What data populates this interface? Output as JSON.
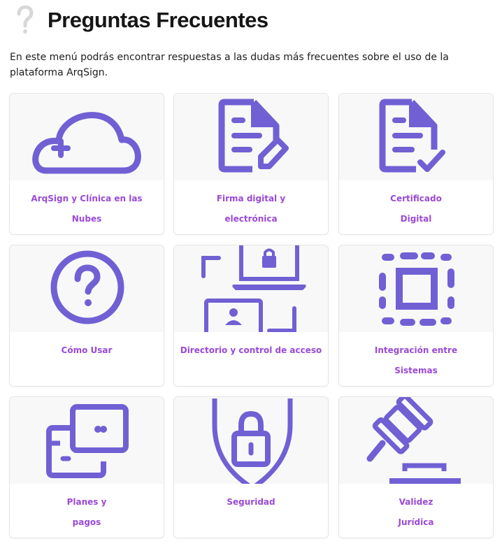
{
  "header": {
    "title": "Preguntas Frecuentes",
    "icon": "question-mark-icon"
  },
  "intro": "En este menú podrás encontrar respuestas a las dudas más frecuentes sobre el uso de la plataforma ArqSign.",
  "colors": {
    "accent": "#7060d4",
    "label": "#9a4ad6",
    "card_top": "#f8f8f8"
  },
  "cards": [
    {
      "icon": "cloud-plus-icon",
      "lines": [
        "ArqSign y Clínica en las Nubes"
      ]
    },
    {
      "icon": "document-edit-icon",
      "lines": [
        "Firma digital y",
        "electrónica"
      ]
    },
    {
      "icon": "document-check-icon",
      "lines": [
        "Certificado",
        "Digital"
      ]
    },
    {
      "icon": "question-circle-icon",
      "lines": [
        "Cómo Usar"
      ]
    },
    {
      "icon": "access-directory-icon",
      "lines": [
        "Directorio y control de acceso"
      ]
    },
    {
      "icon": "integration-icon",
      "lines": [
        "Integración entre",
        "Sistemas"
      ]
    },
    {
      "icon": "payment-cards-icon",
      "lines": [
        "Planes y",
        "pagos"
      ]
    },
    {
      "icon": "shield-lock-icon",
      "lines": [
        "Seguridad"
      ]
    },
    {
      "icon": "gavel-icon",
      "lines": [
        "Validez",
        "Jurídica"
      ]
    }
  ]
}
